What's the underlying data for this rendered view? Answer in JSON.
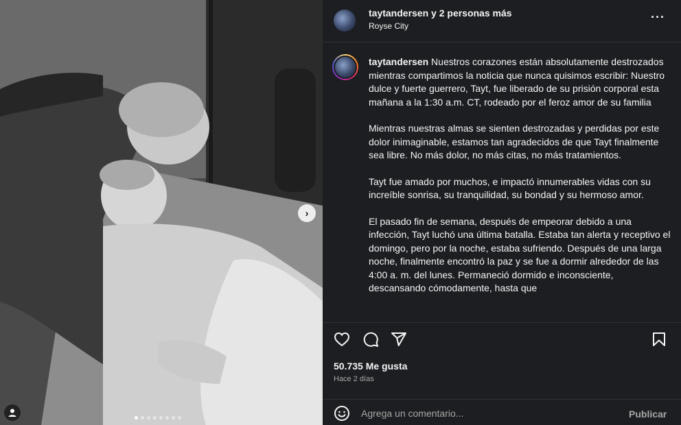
{
  "photo": {
    "alt_subject": "black-and-white hospital photo",
    "carousel": {
      "total_dots": 8,
      "active_index": 0
    },
    "next_icon": "chevron-right-icon",
    "tag_icon": "user-tag-icon"
  },
  "header": {
    "title": "taytandersen y 2 personas más",
    "location": "Royse City",
    "more_icon": "more-horizontal-icon"
  },
  "caption": {
    "username": "taytandersen",
    "paragraphs": [
      "Nuestros corazones están absolutamente destrozados mientras compartimos la noticia que nunca quisimos escribir: Nuestro dulce y fuerte guerrero, Tayt, fue liberado de su prisión corporal esta mañana a la 1:30 a.m. CT, rodeado por el feroz amor de su familia",
      "Mientras nuestras almas se sienten destrozadas y perdidas por este dolor inimaginable, estamos tan agradecidos de que Tayt finalmente sea libre. No más dolor, no más citas, no más tratamientos.",
      "Tayt fue amado por muchos, e impactó innumerables vidas con su increíble sonrisa, su tranquilidad, su bondad y su hermoso amor.",
      "El pasado fin de semana, después de empeorar debido a una infección, Tayt luchó una última batalla. Estaba tan alerta y receptivo el domingo, pero por la noche, estaba sufriendo. Después de una larga noche, finalmente encontró la paz y se fue a dormir alrededor de las 4:00 a. m. del lunes. Permaneció dormido e inconsciente, descansando cómodamente, hasta que"
    ]
  },
  "actions": {
    "icons": [
      "heart-icon",
      "comment-icon",
      "share-icon",
      "bookmark-icon"
    ],
    "likes": "50.735 Me gusta",
    "time": "Hace 2 días"
  },
  "comment": {
    "placeholder": "Agrega un comentario...",
    "publish_label": "Publicar",
    "emoji_icon": "emoji-icon"
  },
  "colors": {
    "panel_bg": "#1c1e21",
    "text": "#f5f5f5",
    "muted": "#a8a8a8"
  }
}
